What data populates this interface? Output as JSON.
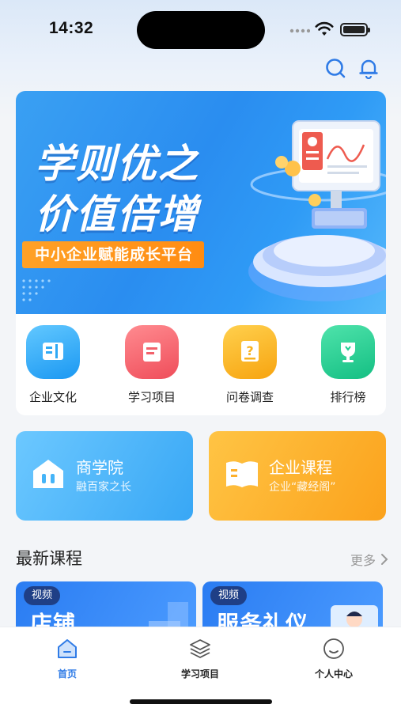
{
  "status_bar": {
    "time": "14:32"
  },
  "header": {
    "icons": [
      "search-icon",
      "bell-icon"
    ],
    "accent": "#2f7be6"
  },
  "banner": {
    "line1": "学则优之",
    "line2": "价值倍增",
    "tagline": "中小企业赋能成长平台"
  },
  "quick_nav": [
    {
      "label": "企业文化",
      "icon": "document-icon",
      "color": "#2ea9f5"
    },
    {
      "label": "学习项目",
      "icon": "list-icon",
      "color": "#f2616b"
    },
    {
      "label": "问卷调查",
      "icon": "question-icon",
      "color": "#f8b21e"
    },
    {
      "label": "排行榜",
      "icon": "trophy-icon",
      "color": "#1fce92"
    }
  ],
  "features": [
    {
      "title": "商学院",
      "subtitle": "融百家之长",
      "icon": "school-icon",
      "color": "#45b4f8"
    },
    {
      "title": "企业课程",
      "subtitle": "企业“藏经阁”",
      "icon": "book-icon",
      "color": "#fdb02c"
    }
  ],
  "latest": {
    "title": "最新课程",
    "more": "更多",
    "courses": [
      {
        "badge": "视频",
        "title": "店铺"
      },
      {
        "badge": "视频",
        "title": "服务礼仪"
      }
    ]
  },
  "tab_bar": {
    "tabs": [
      {
        "label": "首页",
        "icon": "home-icon",
        "active": true
      },
      {
        "label": "学习项目",
        "icon": "layers-icon",
        "active": false
      },
      {
        "label": "个人中心",
        "icon": "smile-icon",
        "active": false
      }
    ]
  }
}
